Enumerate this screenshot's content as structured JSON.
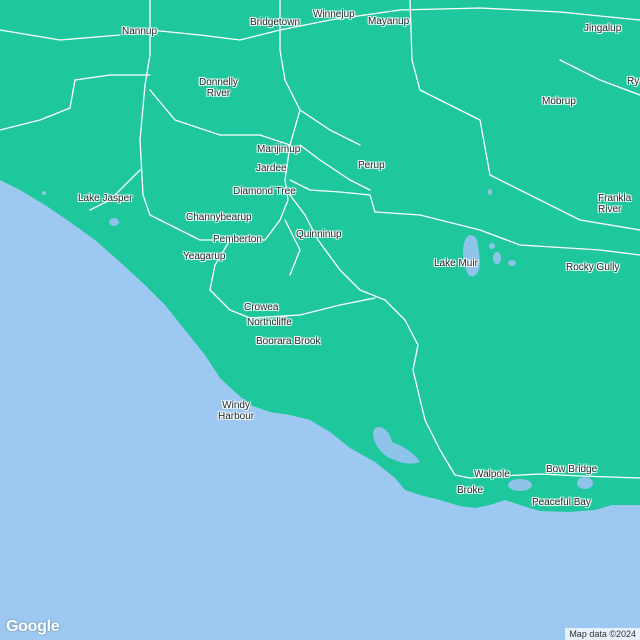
{
  "map": {
    "colors": {
      "land": "#1ec79c",
      "water": "#9cc8f2",
      "road": "#ffffff",
      "lake": "#8ec3ea"
    },
    "places": [
      {
        "id": "nannup",
        "name": "Nannup"
      },
      {
        "id": "bridgetown",
        "name": "Bridgetown"
      },
      {
        "id": "winnejup",
        "name": "Winnejup"
      },
      {
        "id": "mayanup",
        "name": "Mayanup"
      },
      {
        "id": "jingalup",
        "name": "Jingalup"
      },
      {
        "id": "ry",
        "name": "Ry"
      },
      {
        "id": "donnelly-river",
        "name": "Donnelly\nRiver"
      },
      {
        "id": "mobrup",
        "name": "Mobrup"
      },
      {
        "id": "manjimup",
        "name": "Manjimup"
      },
      {
        "id": "jardee",
        "name": "Jardee"
      },
      {
        "id": "perup",
        "name": "Perup"
      },
      {
        "id": "diamond-tree",
        "name": "Diamond Tree"
      },
      {
        "id": "lake-jasper",
        "name": "Lake Jasper"
      },
      {
        "id": "frankland-river",
        "name": "Frankla\nRiver"
      },
      {
        "id": "channybearup",
        "name": "Channybearup"
      },
      {
        "id": "quinninup",
        "name": "Quinninup"
      },
      {
        "id": "pemberton",
        "name": "Pemberton"
      },
      {
        "id": "yeagarup",
        "name": "Yeagarup"
      },
      {
        "id": "lake-muir",
        "name": "Lake Muir"
      },
      {
        "id": "rocky-gully",
        "name": "Rocky Gully"
      },
      {
        "id": "crowea",
        "name": "Crowea"
      },
      {
        "id": "northcliffe",
        "name": "Northcliffe"
      },
      {
        "id": "boorara-brook",
        "name": "Boorara Brook"
      },
      {
        "id": "windy-harbour",
        "name": "Windy\nHarbour"
      },
      {
        "id": "walpole",
        "name": "Walpole"
      },
      {
        "id": "bow-bridge",
        "name": "Bow Bridge"
      },
      {
        "id": "broke",
        "name": "Broke"
      },
      {
        "id": "peaceful-bay",
        "name": "Peaceful Bay"
      }
    ]
  },
  "branding": {
    "logo_text": "Google",
    "attribution": "Map data ©2024"
  }
}
